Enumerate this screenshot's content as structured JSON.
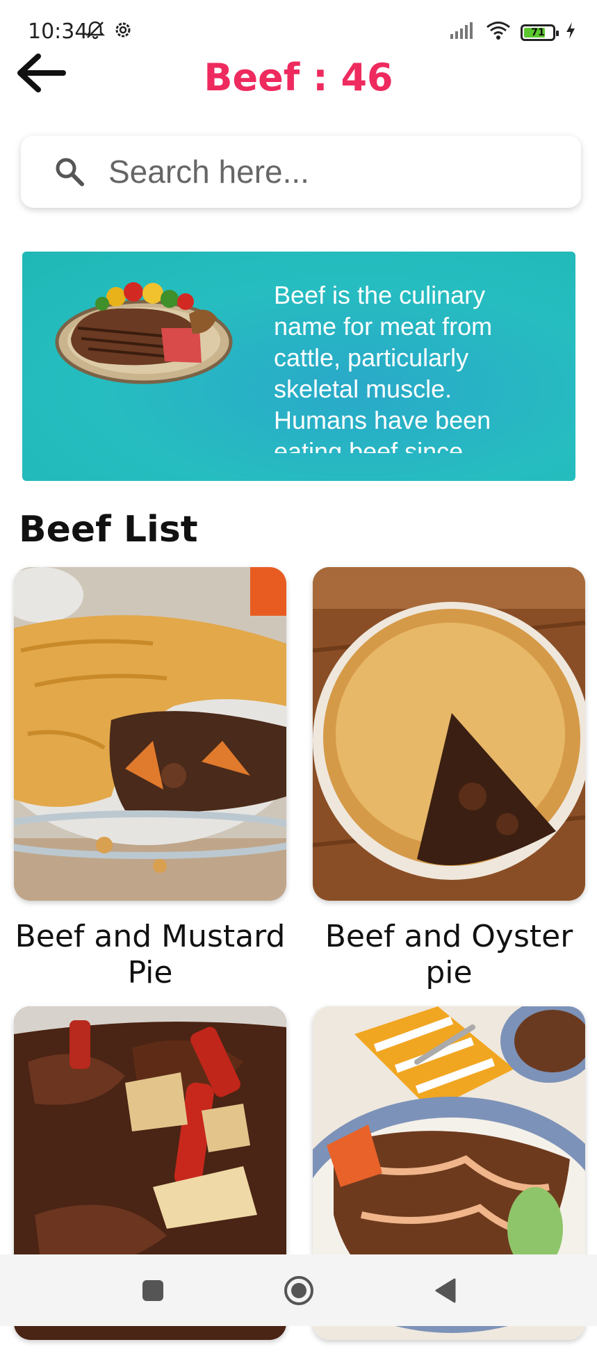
{
  "status_bar": {
    "time": "10:34",
    "battery_level": "71",
    "icons": [
      "bell-off-icon",
      "settings-icon",
      "signal-icon",
      "wifi-icon",
      "battery-icon",
      "charging-icon"
    ]
  },
  "header": {
    "title": "Beef : 46",
    "back_icon": "arrow-left-icon"
  },
  "search": {
    "placeholder": "Search here..."
  },
  "banner": {
    "text": "Beef is the culinary name for meat from cattle, particularly skeletal muscle. Humans have been eating beef since"
  },
  "section": {
    "title": "Beef List"
  },
  "meals": [
    {
      "name": "Beef and Mustard Pie"
    },
    {
      "name": "Beef and Oyster pie"
    },
    {
      "name": ""
    },
    {
      "name": ""
    }
  ],
  "colors": {
    "accent": "#ee2a5e",
    "banner": "#26bdc0"
  }
}
